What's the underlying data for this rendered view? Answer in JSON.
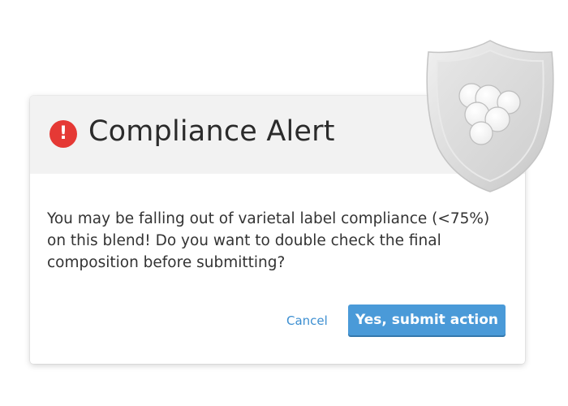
{
  "dialog": {
    "title": "Compliance Alert",
    "alert_icon_glyph": "!",
    "alert_icon_name": "error-circle-icon",
    "message_lines": [
      "You may be falling out of varietal label compliance (<75%)",
      "on this blend! Do you want to double check the final",
      "composition before submitting?"
    ],
    "cancel_label": "Cancel",
    "confirm_label": "Yes, submit action"
  },
  "decoration": {
    "badge_icon_name": "shield-grape-icon"
  },
  "colors": {
    "header_bg": "#f2f2f2",
    "alert_red": "#e53935",
    "link_blue": "#3d8fd1",
    "button_blue": "#4a9ad8",
    "shield_gray": "#dcdcdc"
  }
}
